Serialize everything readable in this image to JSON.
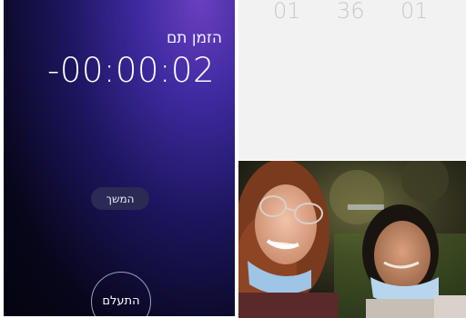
{
  "timer_alert": {
    "title": "הזמן תם",
    "elapsed": "-00:00:02",
    "continue_label": "המשך",
    "dismiss_label": "התעלם"
  },
  "picker": {
    "values": [
      "01",
      "36",
      "01"
    ]
  },
  "photo": {
    "description_icon": "photo-image"
  },
  "colors": {
    "accent_purple": "#5a35b8",
    "panel_dark": "#07061a",
    "picker_bg": "#f2f2f2"
  }
}
